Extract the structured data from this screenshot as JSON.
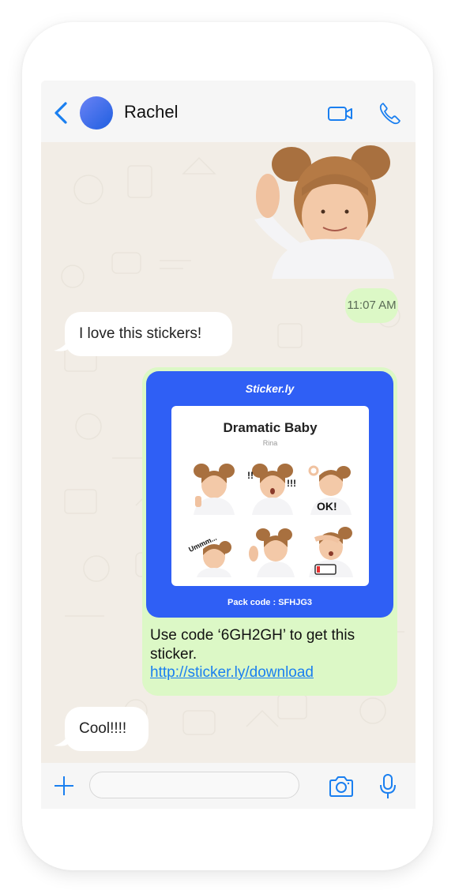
{
  "header": {
    "contact_name": "Rachel",
    "back_icon": "chevron-left-icon",
    "video_icon": "video-camera-icon",
    "call_icon": "phone-icon"
  },
  "messages": [
    {
      "type": "sticker",
      "direction": "outgoing",
      "description": "girl raising hand sticker"
    },
    {
      "type": "text",
      "direction": "outgoing",
      "text": "11:07 AM"
    },
    {
      "type": "text",
      "direction": "incoming",
      "text": "I love this stickers!"
    },
    {
      "type": "sticker-pack",
      "direction": "outgoing",
      "card": {
        "brand": "Sticker.ly",
        "pack_title": "Dramatic Baby",
        "pack_author": "Rina",
        "stickers": [
          {
            "caption": ""
          },
          {
            "caption": "!! !!!"
          },
          {
            "caption": "OK!"
          },
          {
            "caption": "Ummm..."
          },
          {
            "caption": ""
          },
          {
            "caption": ""
          }
        ],
        "pack_code": "Pack code : SFHJG3"
      },
      "text": "Use code ‘6GH2GH’ to get this sticker.",
      "link": "http://sticker.ly/download"
    },
    {
      "type": "text",
      "direction": "incoming",
      "text": "Cool!!!!"
    }
  ],
  "footer": {
    "input_value": "",
    "input_placeholder": "",
    "plus_icon": "plus-icon",
    "camera_icon": "camera-icon",
    "mic_icon": "microphone-icon"
  },
  "colors": {
    "accent": "#1a7ff0",
    "outgoing_bubble": "#dcf8c6",
    "incoming_bubble": "#ffffff",
    "chat_background": "#f2ede6",
    "sticker_card": "#2f5ff5"
  }
}
